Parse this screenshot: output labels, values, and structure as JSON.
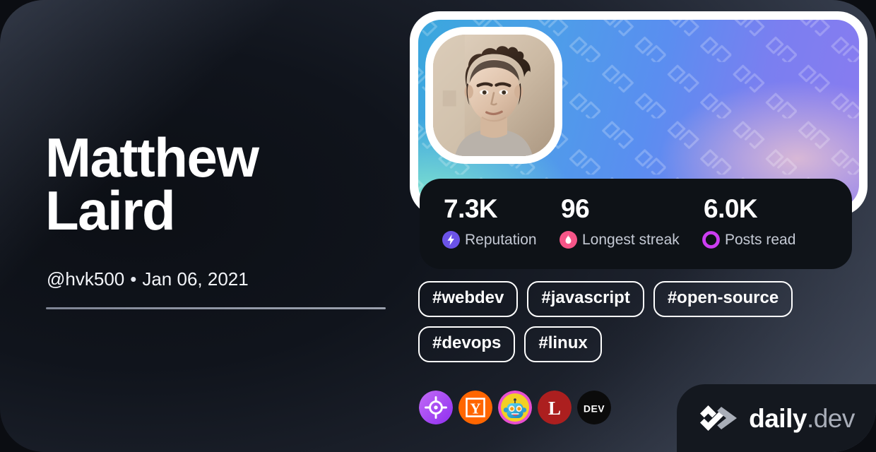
{
  "profile": {
    "name": "Matthew Laird",
    "handle": "@hvk500",
    "separator": "•",
    "joined_date": "Jan 06, 2021",
    "avatar_alt": "user-avatar-photo"
  },
  "stats": [
    {
      "value": "7.3K",
      "label": "Reputation",
      "icon": "bolt-icon",
      "color": "#6b53e8"
    },
    {
      "value": "96",
      "label": "Longest streak",
      "icon": "flame-icon",
      "color": "#f65588"
    },
    {
      "value": "6.0K",
      "label": "Posts read",
      "icon": "ring-icon",
      "color": "#cd3df2"
    }
  ],
  "tags": [
    {
      "label": "#webdev"
    },
    {
      "label": "#javascript"
    },
    {
      "label": "#open-source"
    },
    {
      "label": "#devops"
    },
    {
      "label": "#linux"
    }
  ],
  "sources": [
    {
      "name": "crosshair-source-icon",
      "color": "#a855f7"
    },
    {
      "name": "hacker-news-source-icon",
      "letter": "Y",
      "color": "#ff6600"
    },
    {
      "name": "robot-source-icon",
      "color": "#f2d024"
    },
    {
      "name": "lobsters-source-icon",
      "letter": "L",
      "color": "#ac1f1f"
    },
    {
      "name": "dev-to-source-icon",
      "letter": "DEV",
      "color": "#0b0b0b"
    }
  ],
  "brand": {
    "name": "daily",
    "tld": ".dev",
    "mark": "daily-dev-logo-mark"
  },
  "theme": {
    "background_dark": "#10141c",
    "background_slate": "#454c5c",
    "panel": "#0e1217",
    "brand_panel": "#14181f",
    "text_primary": "#ffffff",
    "text_muted": "#c4c9d4",
    "cover_gradient_from": "#3aa7dd",
    "cover_gradient_to": "#8b7bf0",
    "frame": "#ffffff"
  }
}
